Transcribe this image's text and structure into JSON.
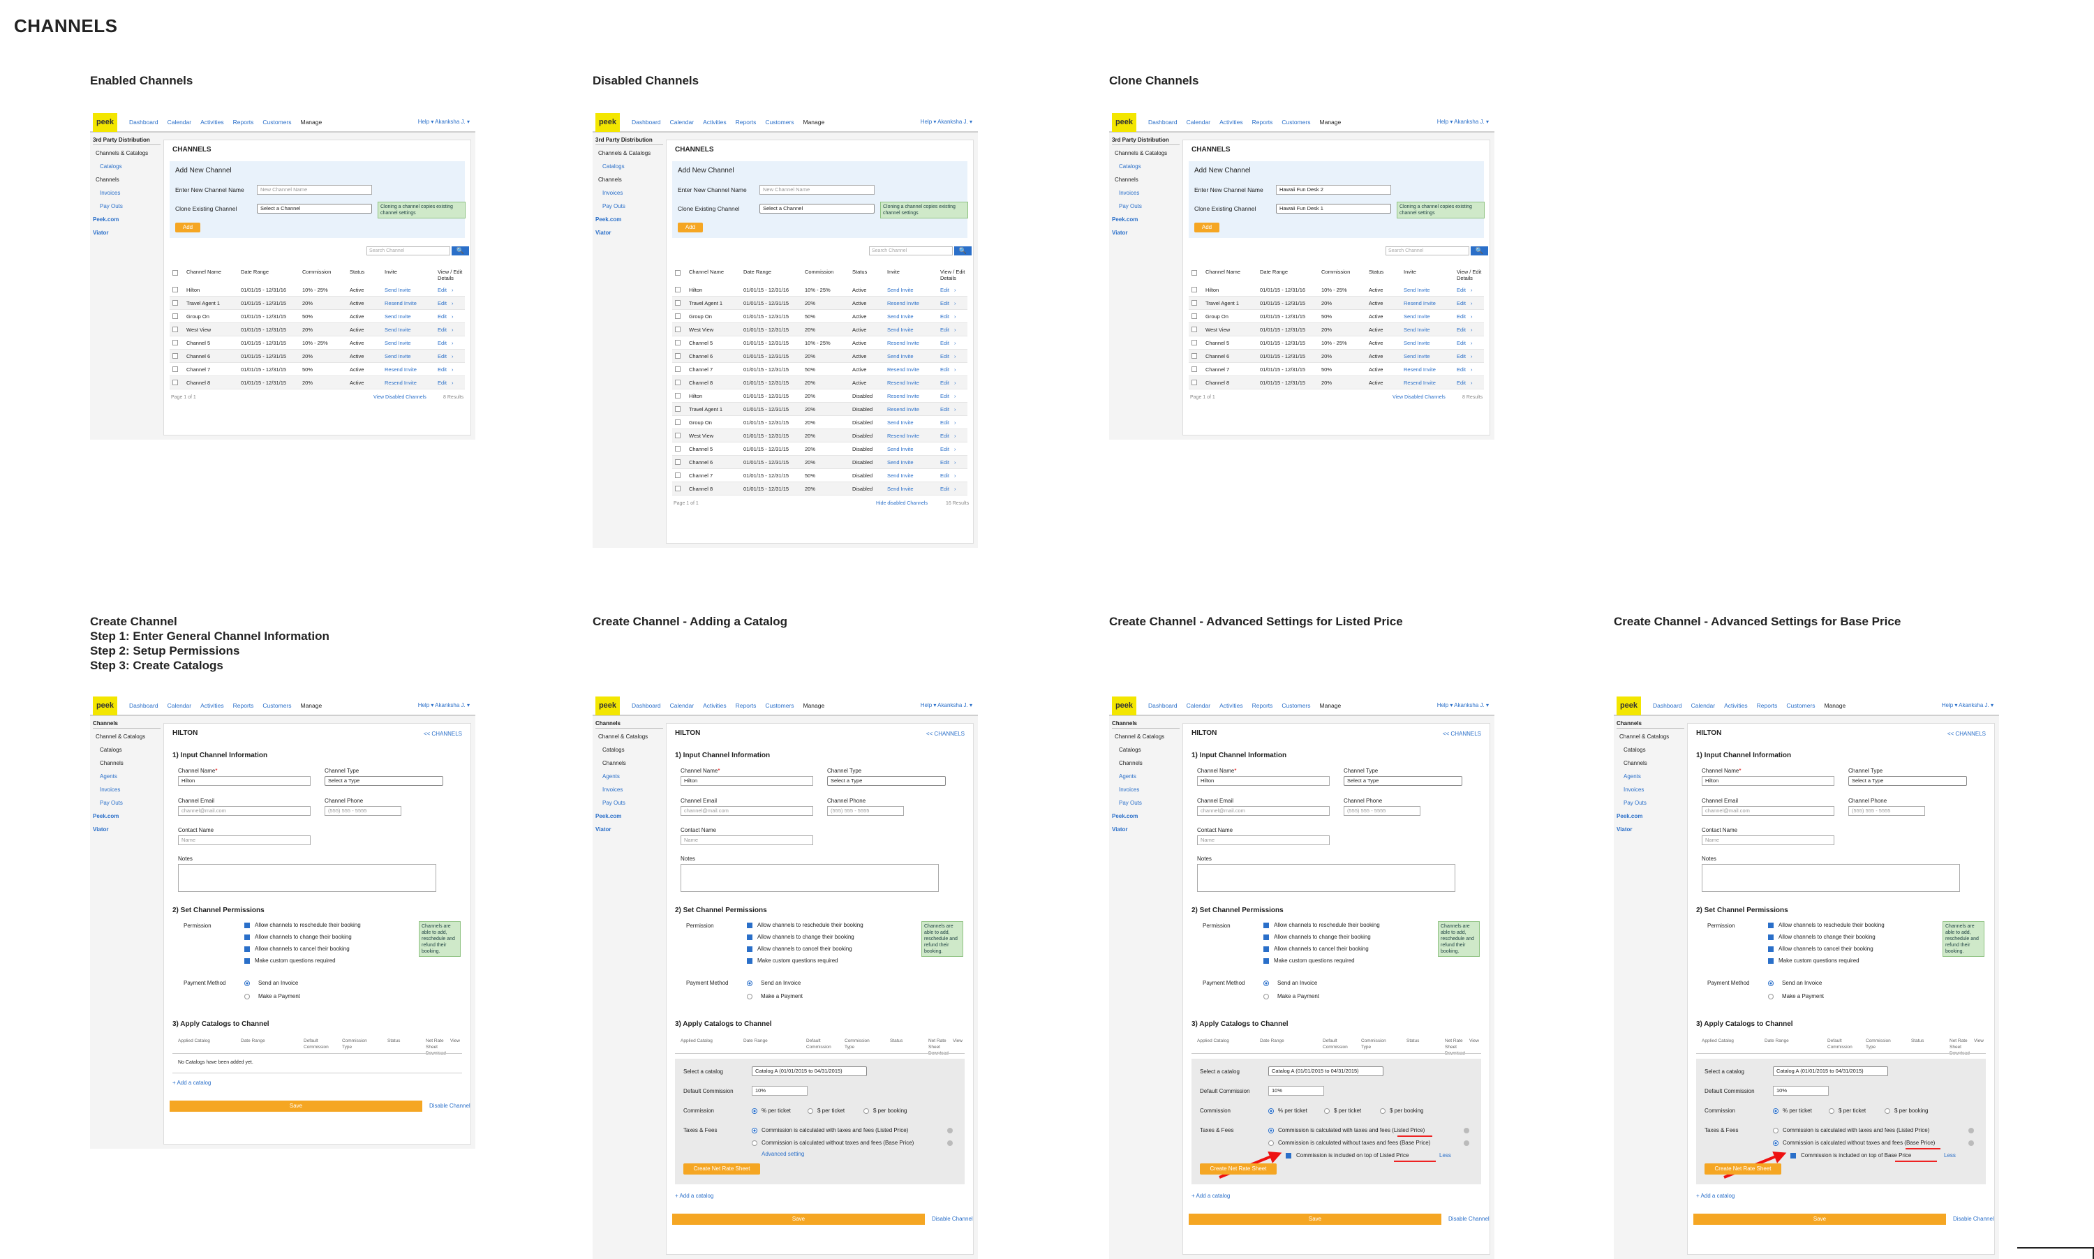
{
  "page_title": "CHANNELS",
  "captions": {
    "enabled": "Enabled Channels",
    "disabled": "Disabled Channels",
    "clone": "Clone Channels",
    "create": "Create Channel\nStep 1: Enter General Channel Information\nStep 2: Setup Permissions\nStep 3: Create Catalogs",
    "create_catalog": "Create Channel - Adding a Catalog",
    "create_listed": "Create Channel - Advanced Settings for Listed Price",
    "create_base": "Create Channel - Advanced Settings for Base Price"
  },
  "topnav": {
    "logo": "peek",
    "items": [
      "Dashboard",
      "Calendar",
      "Activities",
      "Reports",
      "Customers",
      "Manage"
    ],
    "help": "Help ▾   Akanksha J. ▾"
  },
  "list_sidebar": {
    "heading": "3rd Party Distribution",
    "items": [
      "Channels & Catalogs",
      "Catalogs",
      "Channels",
      "Invoices",
      "Pay Outs",
      "Peek.com",
      "Viator"
    ]
  },
  "list_panel": {
    "title": "CHANNELS",
    "add_title": "Add New Channel",
    "name_label": "Enter New Channel Name",
    "name_placeholder": "New Channel Name",
    "clone_label": "Clone Existing Channel",
    "clone_select": "Select a Channel",
    "clone_tip": "Cloning a channel copies existing channel settings",
    "add_button": "Add",
    "search_placeholder": "Search Channel",
    "search_icon": "🔍",
    "headers": [
      "Channel Name",
      "Date Range",
      "Commission",
      "Status",
      "Invite",
      "View / Edit Details"
    ],
    "edit_label": "Edit"
  },
  "enabled_rows": [
    [
      "Hilton",
      "01/01/15 - 12/31/16",
      "10% - 25%",
      "Active",
      "Send Invite"
    ],
    [
      "Travel Agent 1",
      "01/01/15 - 12/31/15",
      "20%",
      "Active",
      "Resend Invite"
    ],
    [
      "Group On",
      "01/01/15 - 12/31/15",
      "50%",
      "Active",
      "Send Invite"
    ],
    [
      "West View",
      "01/01/15 - 12/31/15",
      "20%",
      "Active",
      "Send Invite"
    ],
    [
      "Channel 5",
      "01/01/15 - 12/31/15",
      "10% - 25%",
      "Active",
      "Send Invite"
    ],
    [
      "Channel 6",
      "01/01/15 - 12/31/15",
      "20%",
      "Active",
      "Send Invite"
    ],
    [
      "Channel 7",
      "01/01/15 - 12/31/15",
      "50%",
      "Active",
      "Resend Invite"
    ],
    [
      "Channel 8",
      "01/01/15 - 12/31/15",
      "20%",
      "Active",
      "Resend Invite"
    ]
  ],
  "enabled_footer": {
    "page": "Page 1 of 1",
    "link": "View Disabled Channels",
    "count": "8 Results"
  },
  "disabled_rows": [
    [
      "Hilton",
      "01/01/15 - 12/31/16",
      "10% - 25%",
      "Active",
      "Send Invite"
    ],
    [
      "Travel Agent 1",
      "01/01/15 - 12/31/15",
      "20%",
      "Active",
      "Resend Invite"
    ],
    [
      "Group On",
      "01/01/15 - 12/31/15",
      "50%",
      "Active",
      "Send Invite"
    ],
    [
      "West View",
      "01/01/15 - 12/31/15",
      "20%",
      "Active",
      "Send Invite"
    ],
    [
      "Channel 5",
      "01/01/15 - 12/31/15",
      "10% - 25%",
      "Active",
      "Resend Invite"
    ],
    [
      "Channel 6",
      "01/01/15 - 12/31/15",
      "20%",
      "Active",
      "Send Invite"
    ],
    [
      "Channel 7",
      "01/01/15 - 12/31/15",
      "50%",
      "Active",
      "Resend Invite"
    ],
    [
      "Channel 8",
      "01/01/15 - 12/31/15",
      "20%",
      "Active",
      "Resend Invite"
    ],
    [
      "Hilton",
      "01/01/15 - 12/31/15",
      "20%",
      "Disabled",
      "Resend Invite"
    ],
    [
      "Travel Agent 1",
      "01/01/15 - 12/31/15",
      "20%",
      "Disabled",
      "Resend Invite"
    ],
    [
      "Group On",
      "01/01/15 - 12/31/15",
      "20%",
      "Disabled",
      "Send Invite"
    ],
    [
      "West View",
      "01/01/15 - 12/31/15",
      "20%",
      "Disabled",
      "Resend Invite"
    ],
    [
      "Channel 5",
      "01/01/15 - 12/31/15",
      "20%",
      "Disabled",
      "Send Invite"
    ],
    [
      "Channel 6",
      "01/01/15 - 12/31/15",
      "20%",
      "Disabled",
      "Send Invite"
    ],
    [
      "Channel 7",
      "01/01/15 - 12/31/15",
      "50%",
      "Disabled",
      "Send Invite"
    ],
    [
      "Channel 8",
      "01/01/15 - 12/31/15",
      "20%",
      "Disabled",
      "Send Invite"
    ]
  ],
  "disabled_footer": {
    "page": "Page 1 of 1",
    "link": "Hide disabled Channels",
    "count": "16 Results"
  },
  "clone_panel": {
    "name_value": "Hawaii Fun Desk 2",
    "clone_value": "Hawaii Fun Desk 1"
  },
  "create_sidebar": {
    "heading": "Channels",
    "items": [
      "Channel & Catalogs",
      "Catalogs",
      "Channels",
      "Agents",
      "Invoices",
      "Pay Outs",
      "Peek.com",
      "Viator"
    ]
  },
  "create_form": {
    "title": "HILTON",
    "back_link": "<< CHANNELS",
    "s1": "1) Input Channel Information",
    "name_label": "Channel Name",
    "name_req": "*",
    "name_value": "Hilton",
    "type_label": "Channel Type",
    "type_value": "Select a Type",
    "email_label": "Channel Email",
    "email_ph": "channel@mail.com",
    "phone_label": "Channel Phone",
    "phone_ph": "(555) 555 - 5555",
    "contact_label": "Contact Name",
    "contact_ph": "Name",
    "notes_label": "Notes",
    "s2": "2) Set Channel Permissions",
    "perm_label": "Permission",
    "perms": [
      "Allow channels to reschedule their booking",
      "Allow channels to change their booking",
      "Allow channels to cancel their booking",
      "Make custom questions required"
    ],
    "perm_tip": "Channels are able to add, reschedule and refund their booking.",
    "pay_label": "Payment Method",
    "pay_options": [
      "Send an Invoice",
      "Make a Payment"
    ],
    "s3": "3) Apply Catalogs to Channel",
    "cat_headers": [
      "Applied Catalog",
      "Date Range",
      "Default Commission",
      "Commission Type",
      "Status",
      "Net Rate Sheet Download",
      "View"
    ],
    "no_catalog": "No Catalogs have been added yet.",
    "add_catalog": "+ Add a catalog",
    "save": "Save",
    "disable": "Disable Channel"
  },
  "catalog_box": {
    "select_label": "Select a catalog",
    "select_value": "Catalog A (01/01/2015 to 04/31/2015)",
    "default_comm_label": "Default Commission",
    "default_comm_value": "10%",
    "comm_label": "Commission",
    "comm_opts": [
      "% per ticket",
      "$ per ticket",
      "$ per booking"
    ],
    "tax_label": "Taxes & Fees",
    "tax_opts": [
      "Commission is calculated with taxes and fees (Listed Price)",
      "Commission is calculated without taxes and fees (Base Price)"
    ],
    "advanced": "Advanced setting",
    "listed_included": "Commission is included on top of Listed Price",
    "base_included": "Commission is included on top of Base Price",
    "less": "Less",
    "create_rate": "Create Net Rate Sheet"
  }
}
